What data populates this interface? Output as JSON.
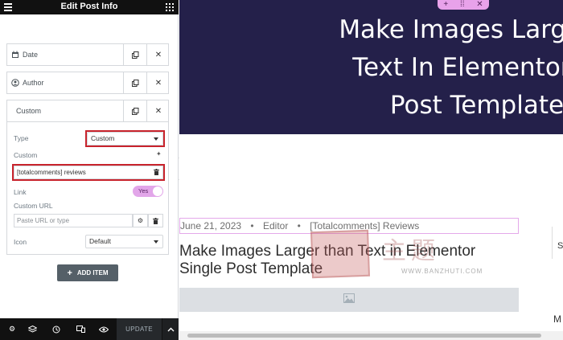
{
  "panel": {
    "title": "Edit Post Info",
    "items": [
      {
        "label": "Date",
        "icon": "calendar-icon"
      },
      {
        "label": "Author",
        "icon": "user-circle-icon"
      },
      {
        "label": "Custom",
        "icon": ""
      }
    ],
    "custom": {
      "type_label": "Type",
      "type_value": "Custom",
      "custom_label": "Custom",
      "custom_value": "[totalcomments] reviews",
      "link_label": "Link",
      "link_toggle": "Yes",
      "custom_url_label": "Custom URL",
      "custom_url_placeholder": "Paste URL or type",
      "icon_label": "Icon",
      "icon_value": "Default"
    },
    "add_item": "ADD ITEM",
    "footer": {
      "update": "UPDATE"
    },
    "colors": {
      "header_bg": "#111111",
      "highlight_border": "#c8232c",
      "toggle_on": "#e2a6e9"
    }
  },
  "preview": {
    "hero_title": "Make Images Larger T\nText In Elementor Si\nPost Template",
    "meta": {
      "date": "June 21, 2023",
      "author": "Editor",
      "comments": "[Totalcomments] Reviews",
      "separator": "•"
    },
    "post_title": "Make Images Larger than Text in Elementor Single Post Template",
    "right_s": "S",
    "right_m": "M",
    "watermark_text": "主题",
    "watermark_url": "WWW.BANZHUTI.COM",
    "colors": {
      "hero_bg": "#24204a",
      "handle": "#e8a2ea"
    }
  }
}
